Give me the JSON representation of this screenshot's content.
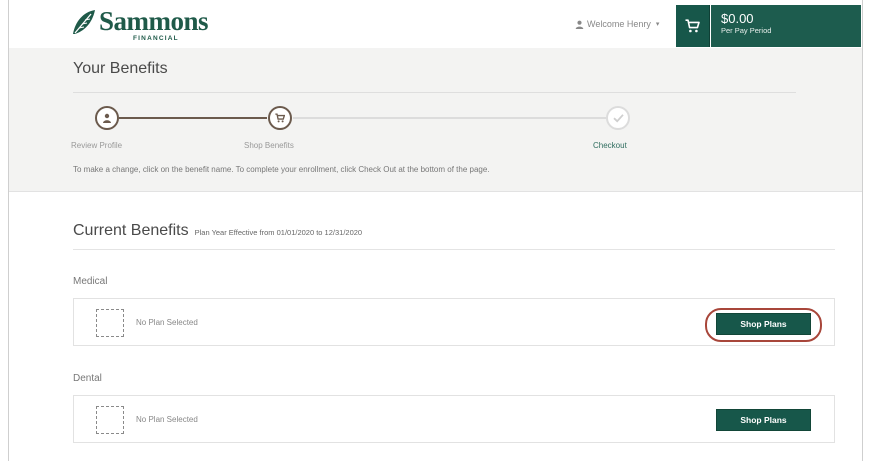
{
  "header": {
    "logo_name": "Sammons",
    "logo_sub": "FINANCIAL",
    "welcome_text": "Welcome Henry",
    "cart_amount": "$0.00",
    "cart_period": "Per Pay Period"
  },
  "band": {
    "title": "Your Benefits",
    "steps": [
      {
        "label": "Review Profile",
        "icon": "person-icon",
        "state": "complete"
      },
      {
        "label": "Shop Benefits",
        "icon": "cart-icon",
        "state": "complete"
      },
      {
        "label": "Checkout",
        "icon": "check-icon",
        "state": "pending"
      }
    ],
    "instructions": "To make a change, click on the benefit name. To complete your enrollment, click Check Out at the bottom of the page."
  },
  "benefits": {
    "title": "Current Benefits",
    "plan_year": "Plan Year Effective from 01/01/2020 to 12/31/2020",
    "categories": [
      {
        "name": "Medical",
        "status": "No Plan Selected",
        "button": "Shop Plans",
        "highlighted": true
      },
      {
        "name": "Dental",
        "status": "No Plan Selected",
        "button": "Shop Plans",
        "highlighted": false
      }
    ]
  },
  "colors": {
    "brand_green": "#17574a",
    "step_complete": "#6b5a4d",
    "highlight_ring": "#a8463a"
  }
}
